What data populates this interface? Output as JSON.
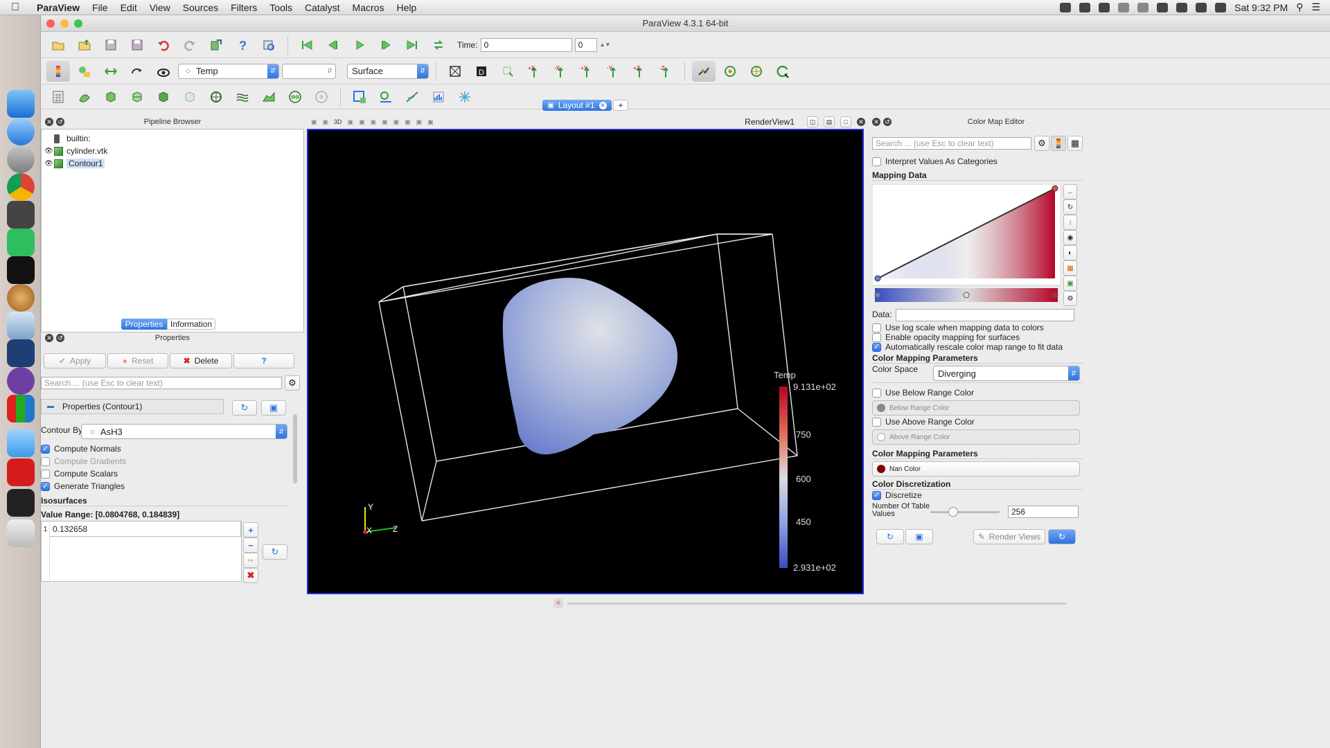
{
  "menubar": {
    "app": "ParaView",
    "items": [
      "File",
      "Edit",
      "View",
      "Sources",
      "Filters",
      "Tools",
      "Catalyst",
      "Macros",
      "Help"
    ],
    "clock": "Sat 9:32 PM"
  },
  "window": {
    "title": "ParaView 4.3.1 64-bit"
  },
  "toolbar1": {
    "time_label": "Time:",
    "time_value": "0",
    "timestep_value": "0"
  },
  "toolbar2": {
    "color_by": "Temp",
    "component": "",
    "representation": "Surface",
    "axis_buttons": [
      "+X",
      "-X",
      "+Y",
      "-Y",
      "+Z",
      "-Z"
    ]
  },
  "pipeline": {
    "title": "Pipeline Browser",
    "items": [
      {
        "label": "builtin:",
        "icon": "server-icon"
      },
      {
        "label": "cylinder.vtk",
        "icon": "cube-icon",
        "visible": true
      },
      {
        "label": "Contour1",
        "icon": "cube-icon",
        "visible": true,
        "selected": true
      }
    ]
  },
  "tabs": {
    "properties": "Properties",
    "information": "Information"
  },
  "properties": {
    "title": "Properties",
    "apply": "Apply",
    "reset": "Reset",
    "delete": "Delete",
    "help": "?",
    "search_placeholder": "Search ... (use Esc to clear text)",
    "group_label": "Properties (Contour1)",
    "contour_by_label": "Contour By",
    "contour_by_value": "AsH3",
    "compute_normals": "Compute Normals",
    "compute_gradients": "Compute Gradients",
    "compute_scalars": "Compute Scalars",
    "generate_triangles": "Generate Triangles",
    "isosurfaces_label": "Isosurfaces",
    "value_range": "Value Range: [0.0804768, 0.184839]",
    "iso_index": "1",
    "iso_value": "0.132658"
  },
  "layout": {
    "tab": "Layout #1",
    "add": "+",
    "render_view": "RenderView1",
    "toolbar_3d": "3D"
  },
  "render": {
    "legend_title": "Temp",
    "legend_max": "9.131e+02",
    "legend_750": "750",
    "legend_600": "600",
    "legend_450": "450",
    "legend_min": "2.931e+02",
    "axis_x": "X",
    "axis_y": "Y",
    "axis_z": "Z"
  },
  "colormap": {
    "title": "Color Map Editor",
    "search_placeholder": "Search ... (use Esc to clear text)",
    "interpret_categories": "Interpret Values As Categories",
    "mapping_data": "Mapping Data",
    "data_label": "Data:",
    "log_scale": "Use log scale when mapping data to colors",
    "opacity_mapping": "Enable opacity mapping for surfaces",
    "auto_rescale": "Automatically rescale color map range to fit data",
    "params_title": "Color Mapping Parameters",
    "color_space_label": "Color Space",
    "color_space_value": "Diverging",
    "use_below": "Use Below Range Color",
    "below_btn": "Below Range Color",
    "use_above": "Use Above Range Color",
    "above_btn": "Above Range Color",
    "params_title2": "Color Mapping Parameters",
    "nan_btn": "Nan Color",
    "discretization_title": "Color Discretization",
    "discretize": "Discretize",
    "table_values_label": "Number Of Table Values",
    "table_values": "256",
    "render_views": "Render Views"
  },
  "colors": {
    "accent": "#2f73de",
    "selection": "#cfe0f7",
    "render_border": "#2a2ae0",
    "colormap_low": "#3b4cc0",
    "colormap_high": "#b40426"
  }
}
